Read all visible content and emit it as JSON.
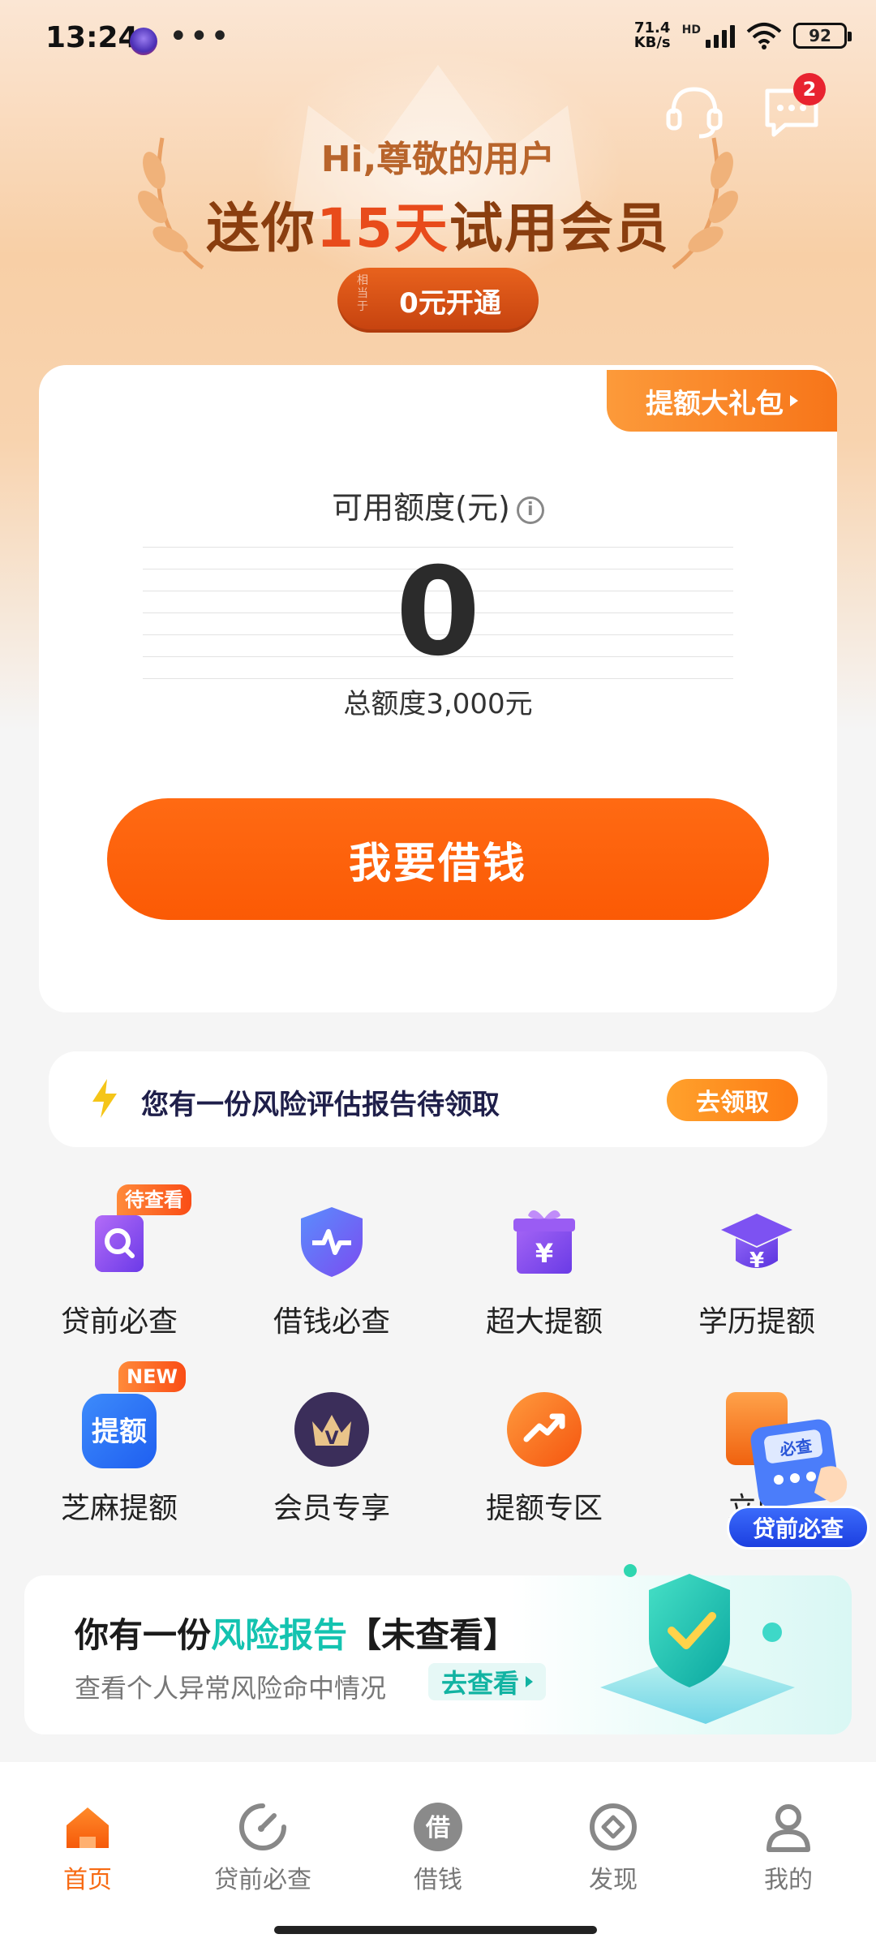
{
  "status_bar": {
    "time": "13:24",
    "dots": "•••",
    "net_speed_value": "71.4",
    "net_speed_unit": "KB/s",
    "hd": "HD",
    "battery": "92"
  },
  "header": {
    "message_badge": "2"
  },
  "hero": {
    "greeting": "Hi,尊敬的用户",
    "title_pre": "送你",
    "title_highlight": "15天",
    "title_post": "试用会员",
    "button_mini": "相当于",
    "button_label": "0元开通"
  },
  "credit": {
    "gift_tag": "提额大礼包",
    "available_label": "可用额度(元)",
    "info_icon": "i",
    "amount": "0",
    "total": "总额度3,000元",
    "borrow_button": "我要借钱"
  },
  "notice": {
    "text": "您有一份风险评估报告待领取",
    "button": "去领取"
  },
  "grid": {
    "items": [
      {
        "label": "贷前必查",
        "tag": "待查看",
        "icon": "loan-check-icon"
      },
      {
        "label": "借钱必查",
        "tag": "",
        "icon": "shield-pulse-icon"
      },
      {
        "label": "超大提额",
        "tag": "",
        "icon": "gift-yuan-icon"
      },
      {
        "label": "学历提额",
        "tag": "",
        "icon": "graduation-icon"
      },
      {
        "label": "芝麻提额",
        "tag": "NEW",
        "icon": "sesame-raise-icon",
        "icon_text": "提额"
      },
      {
        "label": "会员专享",
        "tag": "",
        "icon": "vip-crown-icon",
        "icon_text": "V"
      },
      {
        "label": "提额专区",
        "tag": "",
        "icon": "trend-up-icon"
      },
      {
        "label": "立即",
        "tag": "",
        "icon": "wallet-icon"
      }
    ]
  },
  "floating": {
    "check_text": "必查",
    "label": "贷前必查"
  },
  "report": {
    "title_pre": "你有一份",
    "title_highlight": "风险报告",
    "title_post": "【未查看】",
    "subtitle": "查看个人异常风险命中情况",
    "cta": "去查看"
  },
  "bottom_nav": {
    "items": [
      {
        "label": "首页",
        "icon": "home-icon",
        "active": true
      },
      {
        "label": "贷前必查",
        "icon": "gauge-icon",
        "active": false
      },
      {
        "label": "借钱",
        "icon": "borrow-icon",
        "icon_text": "借",
        "active": false
      },
      {
        "label": "发现",
        "icon": "compass-icon",
        "active": false
      },
      {
        "label": "我的",
        "icon": "profile-icon",
        "active": false
      }
    ]
  },
  "colors": {
    "accent": "#fb5a05",
    "teal": "#14c3b0",
    "badge": "#e8232f"
  }
}
